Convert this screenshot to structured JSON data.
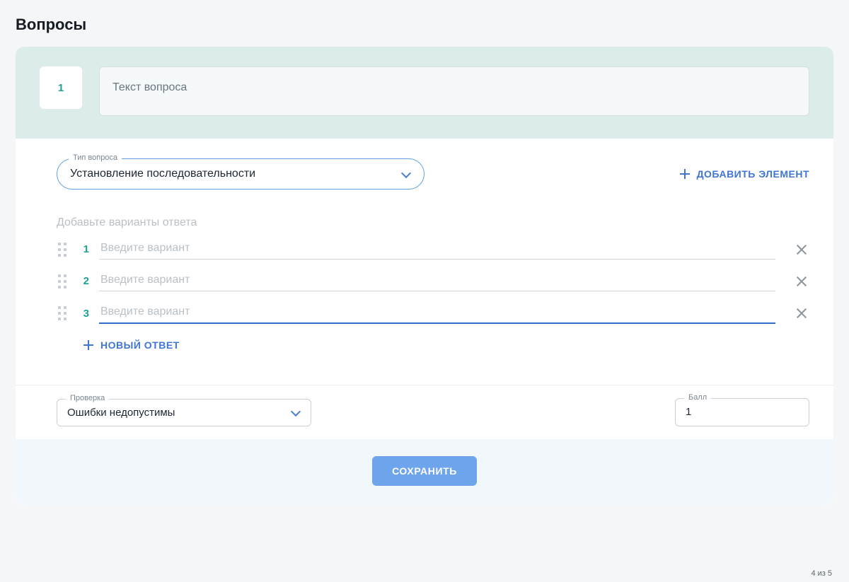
{
  "page_title": "Вопросы",
  "question": {
    "number": "1",
    "text_placeholder": "Текст вопроса"
  },
  "type_field": {
    "label": "Тип вопроса",
    "value": "Установление последовательности"
  },
  "add_element_label": "ДОБАВИТЬ ЭЛЕМЕНТ",
  "variants": {
    "hint": "Добавьте варианты ответа",
    "rows": [
      {
        "n": "1",
        "placeholder": "Введите вариант",
        "focused": false
      },
      {
        "n": "2",
        "placeholder": "Введите вариант",
        "focused": false
      },
      {
        "n": "3",
        "placeholder": "Введите вариант",
        "focused": true
      }
    ],
    "new_answer_label": "НОВЫЙ ОТВЕТ"
  },
  "check_field": {
    "label": "Проверка",
    "value": "Ошибки недопустимы"
  },
  "score_field": {
    "label": "Балл",
    "value": "1"
  },
  "save_label": "СОХРАНИТЬ",
  "page_counter": "4 из 5"
}
